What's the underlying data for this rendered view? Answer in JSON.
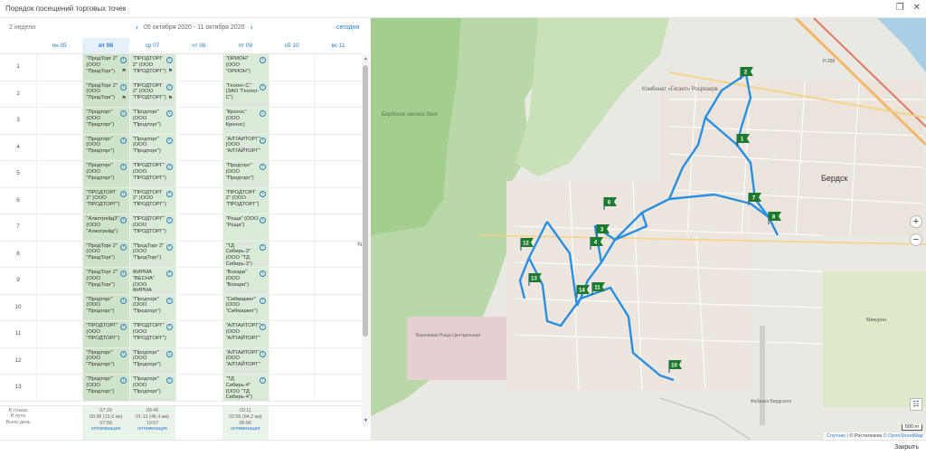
{
  "window": {
    "title": "Порядок посещений торговых точек",
    "close_label": "Закрыть"
  },
  "header": {
    "weeks_label": "2 недели",
    "date_range": "05 октября 2020 - 11 октября 2020",
    "today_label": "сегодня"
  },
  "days": [
    {
      "label": "пн 05",
      "active": false,
      "selected": false
    },
    {
      "label": "вт 06",
      "active": true,
      "selected": true
    },
    {
      "label": "ср 07",
      "active": true,
      "selected": false
    },
    {
      "label": "чт 08",
      "active": false,
      "selected": false
    },
    {
      "label": "пт 09",
      "active": true,
      "selected": false
    },
    {
      "label": "сб 10",
      "active": false,
      "selected": false
    },
    {
      "label": "вс 11",
      "active": false,
      "selected": false
    }
  ],
  "rows": [
    {
      "num": "1",
      "tue": "\"ПродТорг 2\" (ООО \"ПродТорг\")",
      "wed": "\"ПРОДТОРГ 2\" (ООО \"ПРОДТОРГ\")",
      "fri": "\"ОРИОН\" (ООО \"ОРИОН\")"
    },
    {
      "num": "2",
      "tue": "\"ПродТорг 2\" (ООО \"ПродТорг\")",
      "wed": "\"ПРОДТОРГ 2\" (ООО \"ПРОДТОРГ\")",
      "fri": "\"Геолог-С\" (ЗАО \"Геолог-С\")"
    },
    {
      "num": "3",
      "tue": "\"Продторг\" (ООО \"Продторг\")",
      "wed": "\"Продторг\" (ООО \"Продторг\")",
      "fri": "\"Кронос\" (ООО Кронос)"
    },
    {
      "num": "4",
      "tue": "\"Продторг\" (ООО \"Продторг\")",
      "wed": "\"Продторг\" (ООО \"Продторг\")",
      "fri": "\"АЛТАЙТОРГ\" (ООО \"АЛТАЙТОРГ\")"
    },
    {
      "num": "5",
      "tue": "\"Продторг\" (ООО \"Продторг\")",
      "wed": "\"ПРОДТОРГ\" (ООО \"ПРОДТОРГ\")",
      "fri": "\"Продторг\" (ООО \"Продторг\")"
    },
    {
      "num": "6",
      "tue": "\"ПРОДТОРГ 2\" (ООО \"ПРОДТОРГ\")",
      "wed": "\"ПРОДТОРГ 2\" (ООО \"ПРОДТОРГ\")",
      "fri": "\"ПРОДТОРГ 2\" (ООО \"ПРОДТОРГ\")"
    },
    {
      "num": "7",
      "tue": "\"АлкотрейдЗ\" (ООО \"Алкотрейд\")",
      "wed": "\"ПРОДТОРГ\" (ООО \"ПРОДТОРГ\")",
      "fri": "\"Роща\" (ООО \"Роща\")"
    },
    {
      "num": "8",
      "tue": "\"ПродТорг 2\" (ООО \"ПродТорг\")",
      "wed": "\"ПродТорг 2\" (ООО \"ПродТорг\")",
      "fri": "\"ТД Сибирь-3\" (ООО \"ТД Сибирь-3\")"
    },
    {
      "num": "9",
      "tue": "\"ПродТорг 2\" (ООО \"ПродТорг\")",
      "wed": "ФИРМА \"ВЕСНА\" (ООО ФИРМА \"ВЕСНА\")",
      "fri": "\"Вохари\" (ООО \"Вохари\")"
    },
    {
      "num": "10",
      "tue": "\"Продторг\" (ООО \"Продторг\")",
      "wed": "\"Продторг\" (ООО \"Продторг\")",
      "fri": "\"Сибмаркет\" (ООО \"Сибмаркет\")"
    },
    {
      "num": "11",
      "tue": "\"ПРОДТОРГ\" (ООО \"ПРОДТОРГ\")",
      "wed": "\"ПРОДТОРГ\" (ООО \"ПРОДТОРГ\")",
      "fri": "\"АЛТАЙТОРГ\" (ООО \"АЛТАЙТОРГ\")"
    },
    {
      "num": "12",
      "tue": "\"Продторг\" (ООО \"Продторг\")",
      "wed": "\"Продторг\" (ООО \"Продторг\")",
      "fri": "\"АЛТАЙТОРГ\" (ООО \"АЛТАЙТОРГ\")"
    },
    {
      "num": "13",
      "tue": "\"Продторг\" (ООО \"Продторг\")",
      "wed": "\"Продторг\" (ООО \"Продторг\")",
      "fri": "\"ТД Сибирь-4\" (ООО \"ТД Сибирь-4\")"
    }
  ],
  "summary": {
    "labels": [
      "В точках",
      "В пути",
      "Всего день"
    ],
    "tue": {
      "at_points": "07:20",
      "on_road": "00:38 (19,9 км)",
      "total": "07:58",
      "action": "оптимизация"
    },
    "wed": {
      "at_points": "09:45",
      "on_road": "01:12 (46,4 км)",
      "total": "10:57",
      "action": "оптимизация"
    },
    "fri": {
      "at_points": "03:11",
      "on_road": "02:55 (94,2 км)",
      "total": "06:06",
      "action": "оптимизация"
    }
  },
  "map": {
    "route_color": "#2b8fe0",
    "marker_color": "#1e7a2e",
    "labels": {
      "city": "Бердск",
      "forest": "Бердское лесное дачи",
      "combinat": "Комбинат «Гигант» Росрезерв",
      "road": "Р-256",
      "micro": "Микурон",
      "bottom": "Березовая Роща Центральная",
      "airport": "Фабрика Бердского"
    },
    "markers": [
      "1",
      "2",
      "3",
      "4",
      "6",
      "7",
      "8",
      "10",
      "11",
      "12",
      "13",
      "14"
    ],
    "attribution_prefix": "Спутник",
    "attribution_mid": " | © Ростелеком ",
    "attribution_link": "© OpenStreetMap",
    "scale": "500 m",
    "zoom_in": "+",
    "zoom_out": "−"
  }
}
